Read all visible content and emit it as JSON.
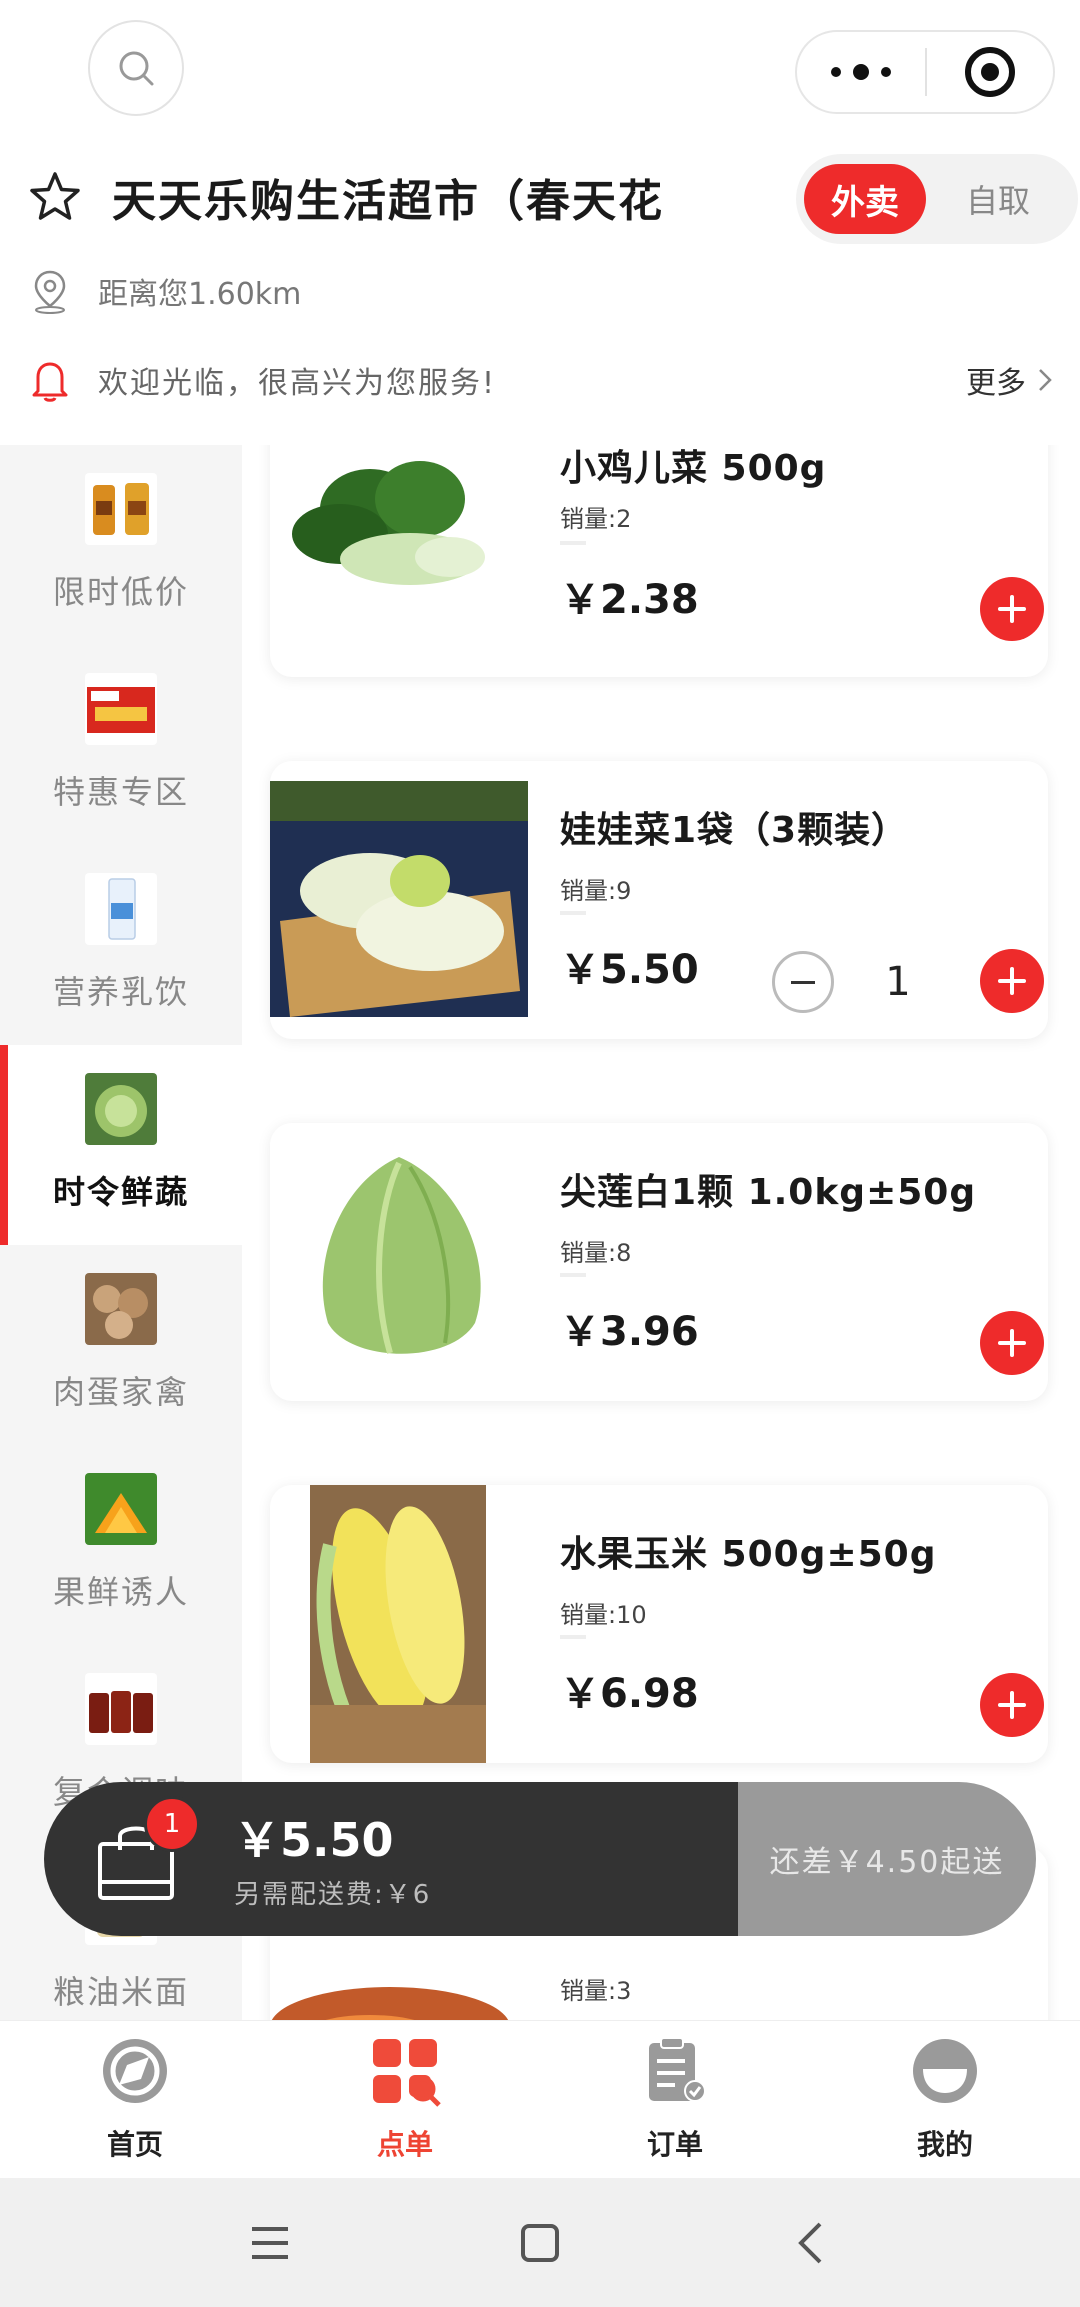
{
  "header": {
    "store_name": "天天乐购生活超市（春天花",
    "mode_delivery": "外卖",
    "mode_pickup": "自取",
    "distance": "距离您1.60km",
    "notice": "欢迎光临，很高兴为您服务!",
    "notice_more": "更多"
  },
  "sidebar": {
    "items": [
      {
        "label": "限时低价"
      },
      {
        "label": "特惠专区"
      },
      {
        "label": "营养乳饮"
      },
      {
        "label": "时令鲜蔬",
        "active": true
      },
      {
        "label": "肉蛋家禽"
      },
      {
        "label": "果鲜诱人"
      },
      {
        "label": "复合调味"
      },
      {
        "label": "粮油米面"
      }
    ]
  },
  "products": [
    {
      "name": "小鸡儿菜 500g",
      "sales": "销量:2",
      "price": "￥2.38"
    },
    {
      "name": "娃娃菜1袋（3颗装）",
      "sales": "销量:9",
      "price": "￥5.50",
      "qty": "1"
    },
    {
      "name": "尖莲白1颗 1.0kg±50g",
      "sales": "销量:8",
      "price": "￥3.96"
    },
    {
      "name": "水果玉米 500g±50g",
      "sales": "销量:10",
      "price": "￥6.98"
    },
    {
      "name": "",
      "sales": "销量:3",
      "price": ""
    }
  ],
  "cart": {
    "badge": "1",
    "total": "￥5.50",
    "fee": "另需配送费:￥6",
    "min_notice": "还差￥4.50起送"
  },
  "tabbar": {
    "tabs": [
      {
        "label": "首页",
        "icon": "home-icon"
      },
      {
        "label": "点单",
        "icon": "order-menu-icon",
        "active": true
      },
      {
        "label": "订单",
        "icon": "orders-icon"
      },
      {
        "label": "我的",
        "icon": "profile-icon"
      }
    ]
  },
  "colors": {
    "accent": "#ee2b2b",
    "cart_dark": "#333333",
    "cart_disabled": "#9a9a9a"
  }
}
